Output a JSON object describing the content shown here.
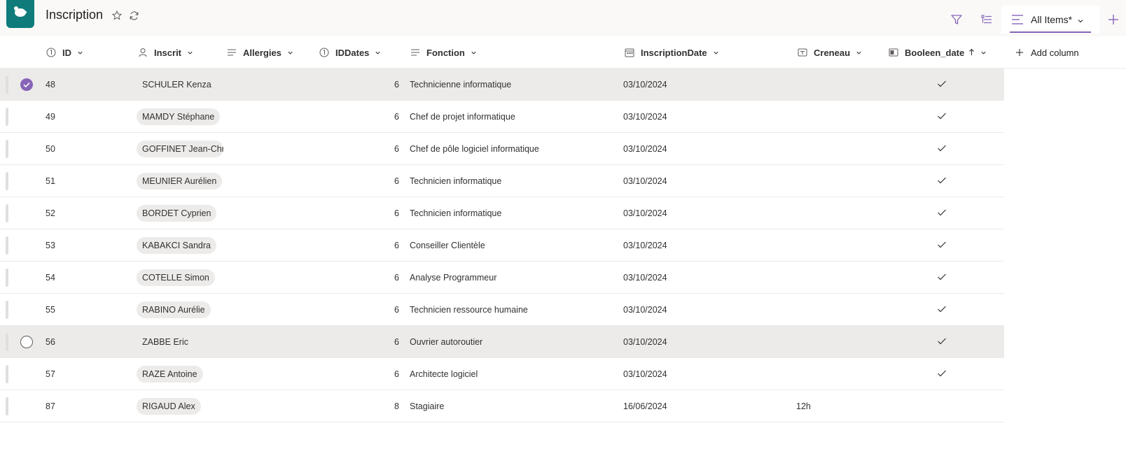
{
  "header": {
    "title": "Inscription",
    "view_label": "All Items*"
  },
  "columns": [
    {
      "label": "ID",
      "icon": "number-icon"
    },
    {
      "label": "Inscrit",
      "icon": "person-icon"
    },
    {
      "label": "Allergies",
      "icon": "text-lines-icon"
    },
    {
      "label": "IDDates",
      "icon": "number-icon"
    },
    {
      "label": "Fonction",
      "icon": "text-lines-icon"
    },
    {
      "label": "InscriptionDate",
      "icon": "calendar-icon"
    },
    {
      "label": "Creneau",
      "icon": "choice-icon"
    },
    {
      "label": "Booleen_date",
      "icon": "yesno-icon",
      "sort": "ascending"
    }
  ],
  "add_column_label": "Add column",
  "rows": [
    {
      "id": "48",
      "inscrit": "SCHULER Kenza",
      "iddates": "6",
      "fonction": "Technicienne informatique",
      "date": "03/10/2024",
      "creneau": "",
      "bool": true,
      "state": "selected"
    },
    {
      "id": "49",
      "inscrit": "MAMDY Stéphane",
      "iddates": "6",
      "fonction": "Chef de projet informatique",
      "date": "03/10/2024",
      "creneau": "",
      "bool": true,
      "state": ""
    },
    {
      "id": "50",
      "inscrit": "GOFFINET Jean-Christ",
      "iddates": "6",
      "fonction": "Chef de pôle logiciel informatique",
      "date": "03/10/2024",
      "creneau": "",
      "bool": true,
      "state": ""
    },
    {
      "id": "51",
      "inscrit": "MEUNIER Aurélien",
      "iddates": "6",
      "fonction": "Technicien informatique",
      "date": "03/10/2024",
      "creneau": "",
      "bool": true,
      "state": ""
    },
    {
      "id": "52",
      "inscrit": "BORDET Cyprien",
      "iddates": "6",
      "fonction": "Technicien informatique",
      "date": "03/10/2024",
      "creneau": "",
      "bool": true,
      "state": ""
    },
    {
      "id": "53",
      "inscrit": "KABAKCI Sandra",
      "iddates": "6",
      "fonction": "Conseiller Clientèle",
      "date": "03/10/2024",
      "creneau": "",
      "bool": true,
      "state": ""
    },
    {
      "id": "54",
      "inscrit": "COTELLE Simon",
      "iddates": "6",
      "fonction": "Analyse Programmeur",
      "date": "03/10/2024",
      "creneau": "",
      "bool": true,
      "state": ""
    },
    {
      "id": "55",
      "inscrit": "RABINO Aurélie",
      "iddates": "6",
      "fonction": "Technicien ressource humaine",
      "date": "03/10/2024",
      "creneau": "",
      "bool": true,
      "state": ""
    },
    {
      "id": "56",
      "inscrit": "ZABBE Eric",
      "iddates": "6",
      "fonction": "Ouvrier autoroutier",
      "date": "03/10/2024",
      "creneau": "",
      "bool": true,
      "state": "hovered"
    },
    {
      "id": "57",
      "inscrit": "RAZE Antoine",
      "iddates": "6",
      "fonction": "Architecte logiciel",
      "date": "03/10/2024",
      "creneau": "",
      "bool": true,
      "state": ""
    },
    {
      "id": "87",
      "inscrit": "RIGAUD Alex",
      "iddates": "8",
      "fonction": "Stagiaire",
      "date": "16/06/2024",
      "creneau": "12h",
      "bool": false,
      "state": ""
    }
  ]
}
